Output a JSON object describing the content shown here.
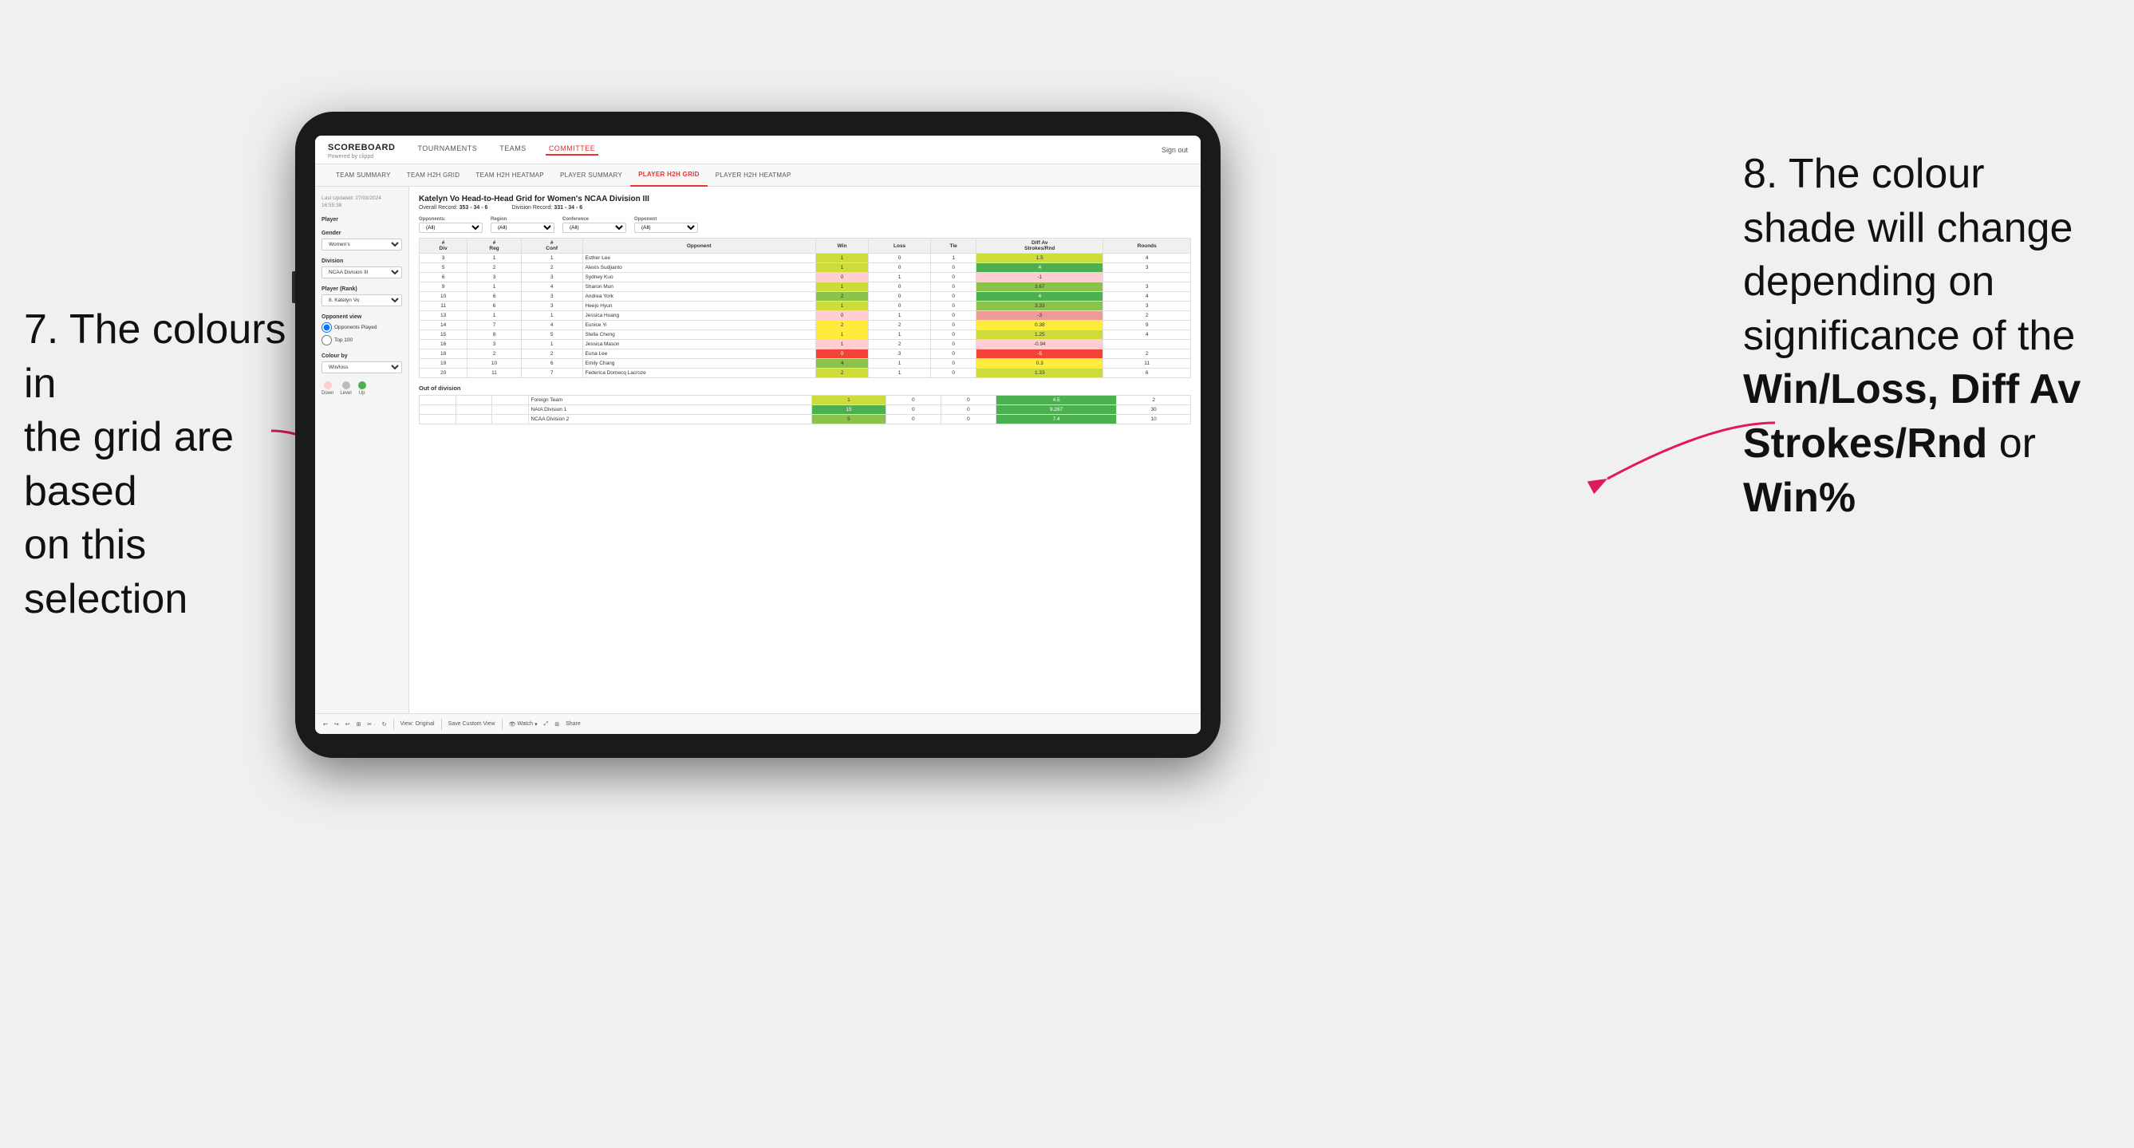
{
  "annotations": {
    "left_text_line1": "7. The colours in",
    "left_text_line2": "the grid are based",
    "left_text_line3": "on this selection",
    "right_text_line1": "8. The colour",
    "right_text_line2": "shade will change",
    "right_text_line3": "depending on",
    "right_text_line4": "significance of the",
    "right_bold_1": "Win/Loss,",
    "right_bold_2": "Diff Av",
    "right_bold_3": "Strokes/Rnd",
    "right_text_line5": "or",
    "right_bold_4": "Win%"
  },
  "nav": {
    "logo": "SCOREBOARD",
    "logo_sub": "Powered by clippd",
    "items": [
      "TOURNAMENTS",
      "TEAMS",
      "COMMITTEE"
    ],
    "sign_out": "Sign out"
  },
  "sub_nav": {
    "items": [
      "TEAM SUMMARY",
      "TEAM H2H GRID",
      "TEAM H2H HEATMAP",
      "PLAYER SUMMARY",
      "PLAYER H2H GRID",
      "PLAYER H2H HEATMAP"
    ]
  },
  "sidebar": {
    "timestamp_label": "Last Updated: 27/03/2024",
    "timestamp_time": "16:55:38",
    "player_label": "Player",
    "gender_label": "Gender",
    "gender_value": "Women's",
    "division_label": "Division",
    "division_value": "NCAA Division III",
    "player_rank_label": "Player (Rank)",
    "player_rank_value": "8. Katelyn Vo",
    "opponent_view_label": "Opponent view",
    "radio_opponents": "Opponents Played",
    "radio_top100": "Top 100",
    "colour_by_label": "Colour by",
    "colour_by_value": "Win/loss",
    "legend_down": "Down",
    "legend_level": "Level",
    "legend_up": "Up"
  },
  "grid": {
    "title": "Katelyn Vo Head-to-Head Grid for Women's NCAA Division III",
    "overall_record_label": "Overall Record:",
    "overall_record": "353 - 34 - 6",
    "division_record_label": "Division Record:",
    "division_record": "331 - 34 - 6",
    "filters": {
      "opponents_label": "Opponents:",
      "opponents_value": "(All)",
      "region_label": "Region",
      "region_value": "(All)",
      "conference_label": "Conference",
      "conference_value": "(All)",
      "opponent_label": "Opponent",
      "opponent_value": "(All)"
    },
    "table_headers": [
      "#Div",
      "#Reg",
      "#Conf",
      "Opponent",
      "Win",
      "Loss",
      "Tie",
      "Diff Av Strokes/Rnd",
      "Rounds"
    ],
    "rows": [
      {
        "div": 3,
        "reg": 1,
        "conf": 1,
        "name": "Esther Lee",
        "win": 1,
        "loss": 0,
        "tie": 1,
        "diff": 1.5,
        "rounds": 4,
        "win_color": "green-light",
        "diff_color": "green-light"
      },
      {
        "div": 5,
        "reg": 2,
        "conf": 2,
        "name": "Alexis Sudjianto",
        "win": 1,
        "loss": 0,
        "tie": 0,
        "diff": 4.0,
        "rounds": 3,
        "win_color": "green-light",
        "diff_color": "green-dark"
      },
      {
        "div": 6,
        "reg": 3,
        "conf": 3,
        "name": "Sydney Kuo",
        "win": 0,
        "loss": 1,
        "tie": 0,
        "diff": -1.0,
        "rounds": "",
        "win_color": "red-light",
        "diff_color": "red-light"
      },
      {
        "div": 9,
        "reg": 1,
        "conf": 4,
        "name": "Sharon Mun",
        "win": 1,
        "loss": 0,
        "tie": 0,
        "diff": 3.67,
        "rounds": 3,
        "win_color": "green-light",
        "diff_color": "green-mid"
      },
      {
        "div": 10,
        "reg": 6,
        "conf": 3,
        "name": "Andrea York",
        "win": 2,
        "loss": 0,
        "tie": 0,
        "diff": 4.0,
        "rounds": 4,
        "win_color": "green-mid",
        "diff_color": "green-dark"
      },
      {
        "div": 11,
        "reg": 6,
        "conf": 3,
        "name": "Heejo Hyun",
        "win": 1,
        "loss": 0,
        "tie": 0,
        "diff": 3.33,
        "rounds": 3,
        "win_color": "green-light",
        "diff_color": "green-mid"
      },
      {
        "div": 13,
        "reg": 1,
        "conf": 1,
        "name": "Jessica Huang",
        "win": 0,
        "loss": 1,
        "tie": 0,
        "diff": -3.0,
        "rounds": 2,
        "win_color": "red-light",
        "diff_color": "red-mid"
      },
      {
        "div": 14,
        "reg": 7,
        "conf": 4,
        "name": "Eunice Yi",
        "win": 2,
        "loss": 2,
        "tie": 0,
        "diff": 0.38,
        "rounds": 9,
        "win_color": "yellow",
        "diff_color": "yellow"
      },
      {
        "div": 15,
        "reg": 8,
        "conf": 5,
        "name": "Stella Cheng",
        "win": 1,
        "loss": 1,
        "tie": 0,
        "diff": 1.25,
        "rounds": 4,
        "win_color": "yellow",
        "diff_color": "green-light"
      },
      {
        "div": 16,
        "reg": 3,
        "conf": 1,
        "name": "Jessica Mason",
        "win": 1,
        "loss": 2,
        "tie": 0,
        "diff": -0.94,
        "rounds": "",
        "win_color": "red-light",
        "diff_color": "red-light"
      },
      {
        "div": 18,
        "reg": 2,
        "conf": 2,
        "name": "Euna Lee",
        "win": 0,
        "loss": 3,
        "tie": 0,
        "diff": -5.0,
        "rounds": 2,
        "win_color": "red-dark",
        "diff_color": "red-dark"
      },
      {
        "div": 19,
        "reg": 10,
        "conf": 6,
        "name": "Emily Chang",
        "win": 4,
        "loss": 1,
        "tie": 0,
        "diff": 0.3,
        "rounds": 11,
        "win_color": "green-mid",
        "diff_color": "yellow"
      },
      {
        "div": 20,
        "reg": 11,
        "conf": 7,
        "name": "Federica Domecq Lacroze",
        "win": 2,
        "loss": 1,
        "tie": 0,
        "diff": 1.33,
        "rounds": 6,
        "win_color": "green-light",
        "diff_color": "green-light"
      }
    ],
    "out_of_division_label": "Out of division",
    "out_of_division_rows": [
      {
        "name": "Foreign Team",
        "win": 1,
        "loss": 0,
        "tie": 0,
        "diff": 4.5,
        "rounds": 2,
        "win_color": "green-light",
        "diff_color": "green-dark"
      },
      {
        "name": "NAIA Division 1",
        "win": 15,
        "loss": 0,
        "tie": 0,
        "diff": 9.267,
        "rounds": 30,
        "win_color": "green-dark",
        "diff_color": "green-dark"
      },
      {
        "name": "NCAA Division 2",
        "win": 5,
        "loss": 0,
        "tie": 0,
        "diff": 7.4,
        "rounds": 10,
        "win_color": "green-mid",
        "diff_color": "green-dark"
      }
    ]
  },
  "toolbar": {
    "view_original": "View: Original",
    "save_custom_view": "Save Custom View",
    "watch": "Watch",
    "share": "Share"
  }
}
